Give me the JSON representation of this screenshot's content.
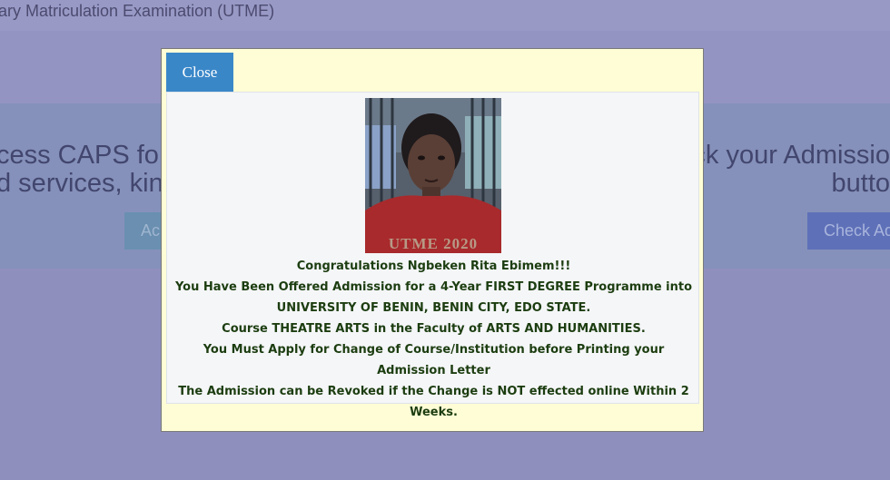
{
  "background": {
    "header_title": "iary Matriculation Examination (UTME)",
    "left_text_line1": "cess CAPS fo",
    "left_text_line2": "d services, kin",
    "right_text_line1": "ck your Admissio",
    "right_text_line2": "butto",
    "left_button": "Ac",
    "right_button": "Check Ad"
  },
  "modal": {
    "close_label": "Close",
    "photo_watermark": "UTME 2020",
    "lines": [
      "Congratulations Ngbeken Rita Ebimem!!!",
      "You Have Been Offered Admission for a 4-Year FIRST DEGREE Programme into",
      "UNIVERSITY OF BENIN, BENIN CITY, EDO STATE.",
      "Course THEATRE ARTS in the Faculty of ARTS AND HUMANITIES.",
      "You Must Apply for Change of Course/Institution before Printing your Admission Letter",
      "The Admission can be Revoked if the Change is NOT effected online Within 2 Weeks."
    ]
  },
  "colors": {
    "overlay": "#8f8fbe",
    "modal_bg": "#fefdd6",
    "close_button": "#3a87c8",
    "message_text": "#1c3d10"
  }
}
